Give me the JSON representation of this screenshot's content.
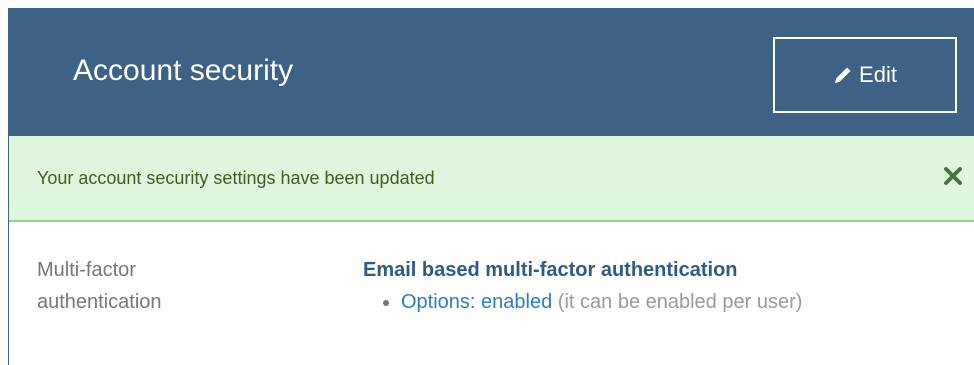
{
  "header": {
    "title": "Account security",
    "edit_label": "Edit",
    "background": "#3d6285"
  },
  "alert": {
    "message": "Your account security settings have been updated",
    "close_icon": "close-icon",
    "background": "#dff7dc"
  },
  "settings": {
    "mfa": {
      "label": "Multi-factor authentication",
      "method_title": "Email based multi-factor authentication",
      "options_text": "Options: enabled",
      "options_note": "(it can be enabled per user)"
    }
  },
  "icons": {
    "edit": "pencil-icon",
    "close": "close-icon"
  }
}
